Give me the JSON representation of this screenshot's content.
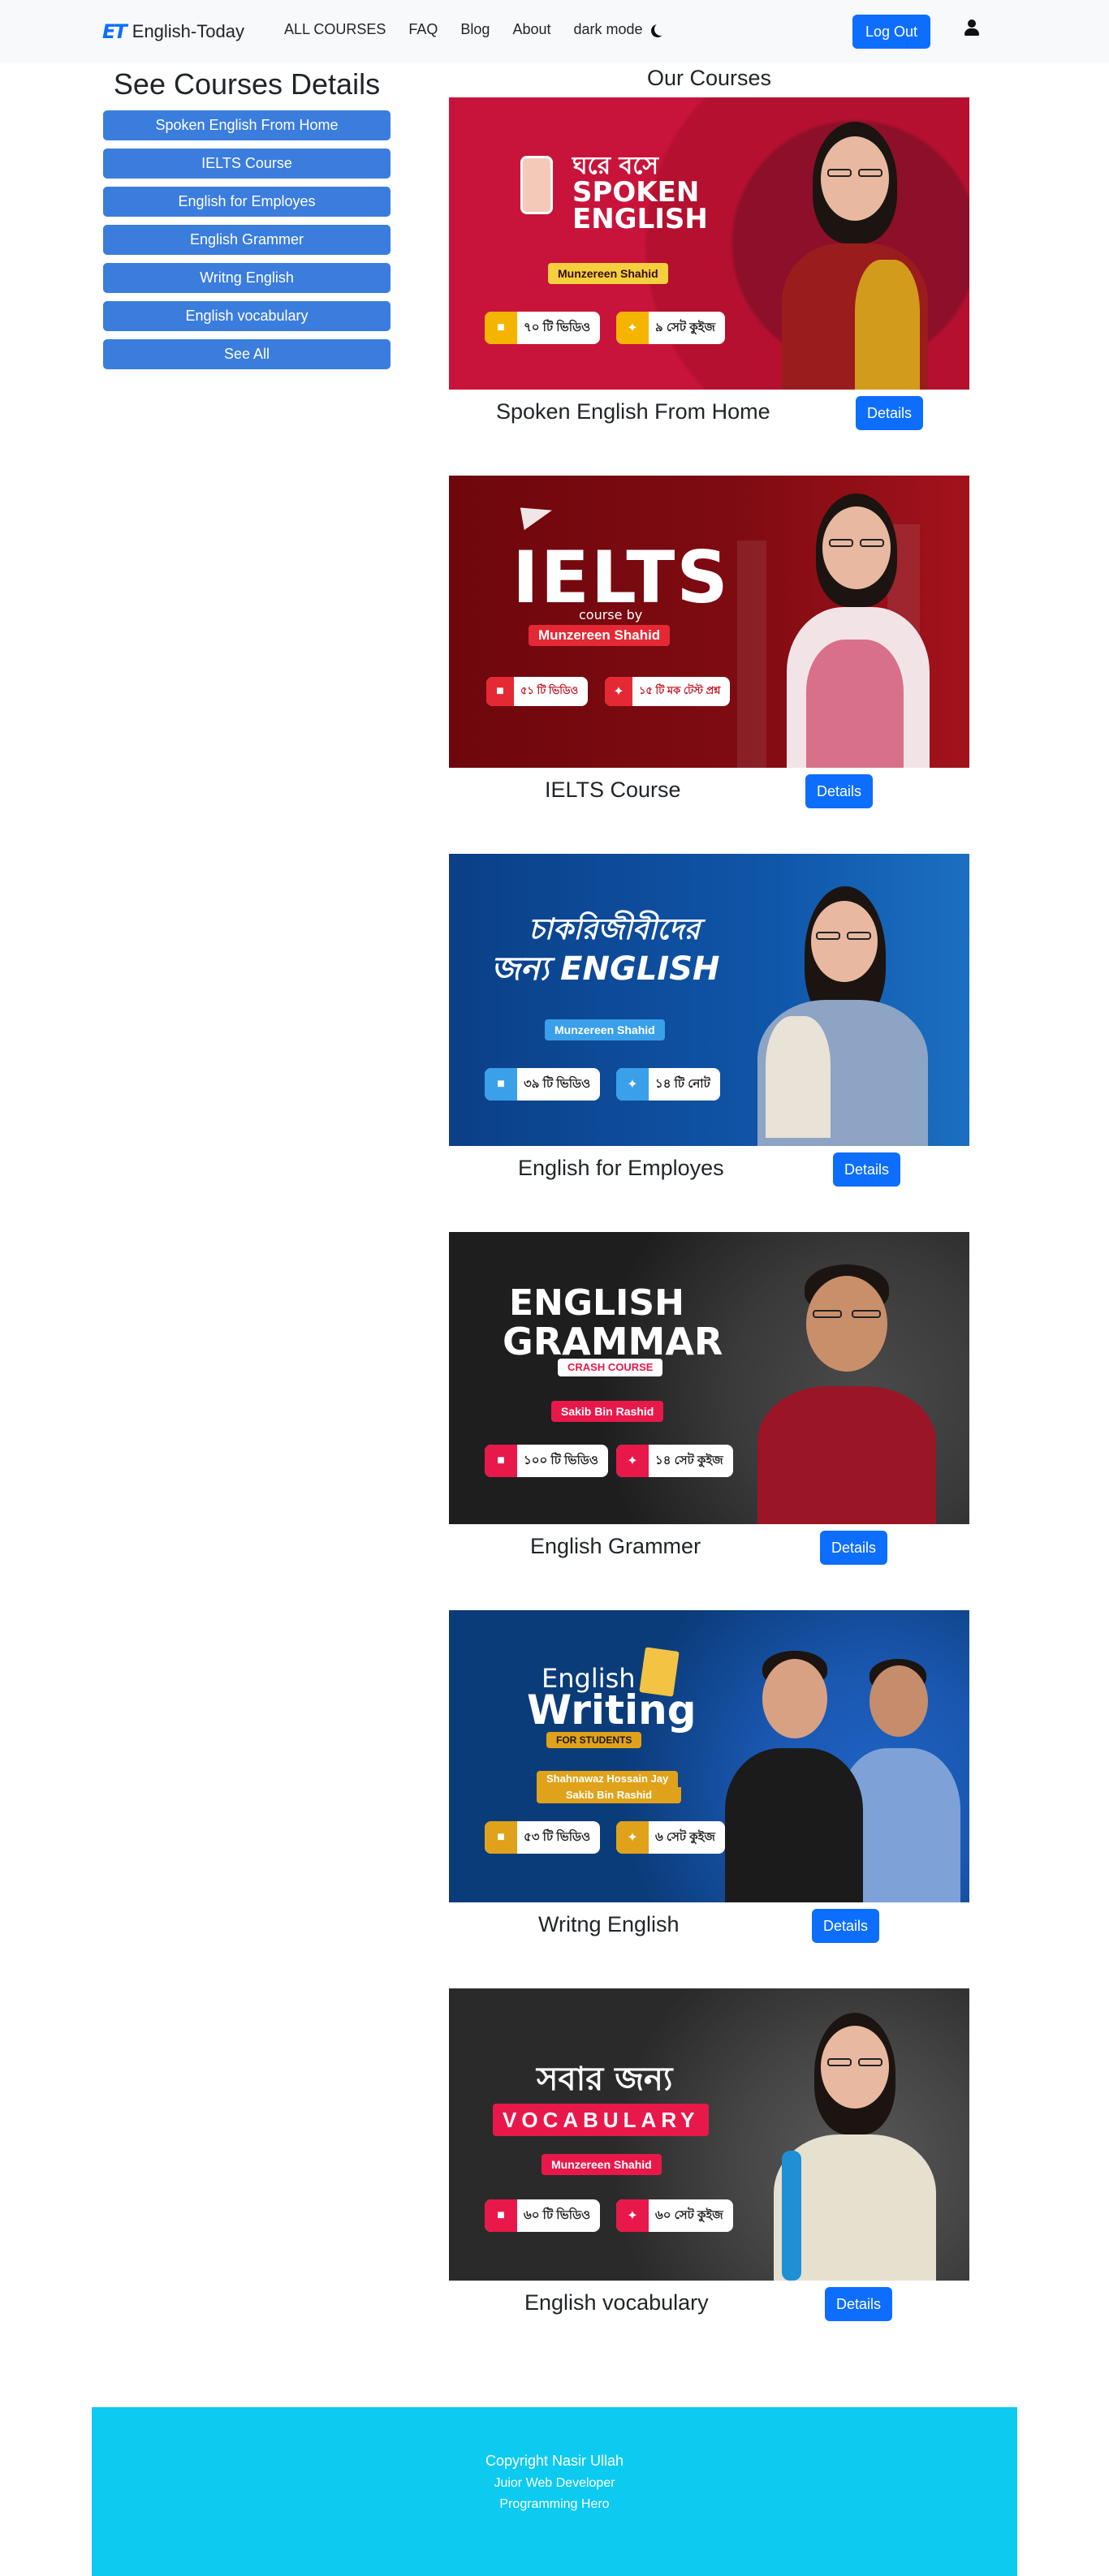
{
  "nav": {
    "logo": "ET",
    "brand": "English-Today",
    "links": [
      "ALL COURSES",
      "FAQ",
      "Blog",
      "About",
      "dark mode"
    ],
    "logout": "Log Out"
  },
  "sidebar": {
    "title": "See Courses Details",
    "items": [
      "Spoken English From Home",
      "IELTS Course",
      "English for Employes",
      "English Grammer",
      "Writng English",
      "English vocabulary",
      "See All"
    ]
  },
  "main": {
    "title": "Our Courses",
    "details_label": "Details",
    "courses": [
      {
        "name": "Spoken English From Home",
        "banner": {
          "title_top": "ঘরে বসে",
          "title_main": "SPOKEN",
          "title_sub": "ENGLISH",
          "instructor": "Munzereen Shahid",
          "stat1": "৭০ টি ভিডিও",
          "stat2": "৯ সেট কুইজ",
          "bg": "#c2133a",
          "accent": "#f4b400"
        }
      },
      {
        "name": "IELTS Course",
        "banner": {
          "title_main": "IELTS",
          "title_sub": "course by",
          "instructor": "Munzereen Shahid",
          "stat1": "৫১ টি ভিডিও",
          "stat2": "১৫ টি মক টেস্ট প্রশ্ন",
          "bg": "#7d0a0f",
          "accent": "#e52934"
        }
      },
      {
        "name": "English for Employes",
        "banner": {
          "title_top": "চাকরিজীবীদের",
          "title_main": "জন্য ENGLISH",
          "instructor": "Munzereen Shahid",
          "stat1": "৩৯ টি ভিডিও",
          "stat2": "১৪ টি নোট",
          "bg": "#0f4f9e",
          "accent": "#3aa0ea"
        }
      },
      {
        "name": "English Grammer",
        "banner": {
          "title_top": "ENGLISH",
          "title_main": "GRAMMAR",
          "title_sub": "CRASH COURSE",
          "instructor": "Sakib Bin Rashid",
          "stat1": "১০০ টি ভিডিও",
          "stat2": "১৪ সেট কুইজ",
          "bg": "#1e1e1e",
          "accent": "#e8194a"
        }
      },
      {
        "name": "Writng English",
        "banner": {
          "title_top": "English",
          "title_main": "Writing",
          "title_sub": "FOR STUDENTS",
          "instructor": "Shahnawaz Hossain Jay",
          "instructor2": "Sakib Bin Rashid",
          "stat1": "৫৩ টি ভিডিও",
          "stat2": "৬ সেট কুইজ",
          "bg": "#0b3c7a",
          "accent": "#e0a21a"
        }
      },
      {
        "name": "English vocabulary",
        "banner": {
          "title_top": "সবার জন্য",
          "title_main": "VOCABULARY",
          "instructor": "Munzereen Shahid",
          "stat1": "৬০ টি ভিডিও",
          "stat2": "৬০ সেট কুইজ",
          "bg": "#242424",
          "accent": "#e8194a"
        }
      }
    ]
  },
  "footer": {
    "line1": "Copyright Nasir Ullah",
    "line2": "Juior Web Developer",
    "line3": "Programming Hero"
  }
}
